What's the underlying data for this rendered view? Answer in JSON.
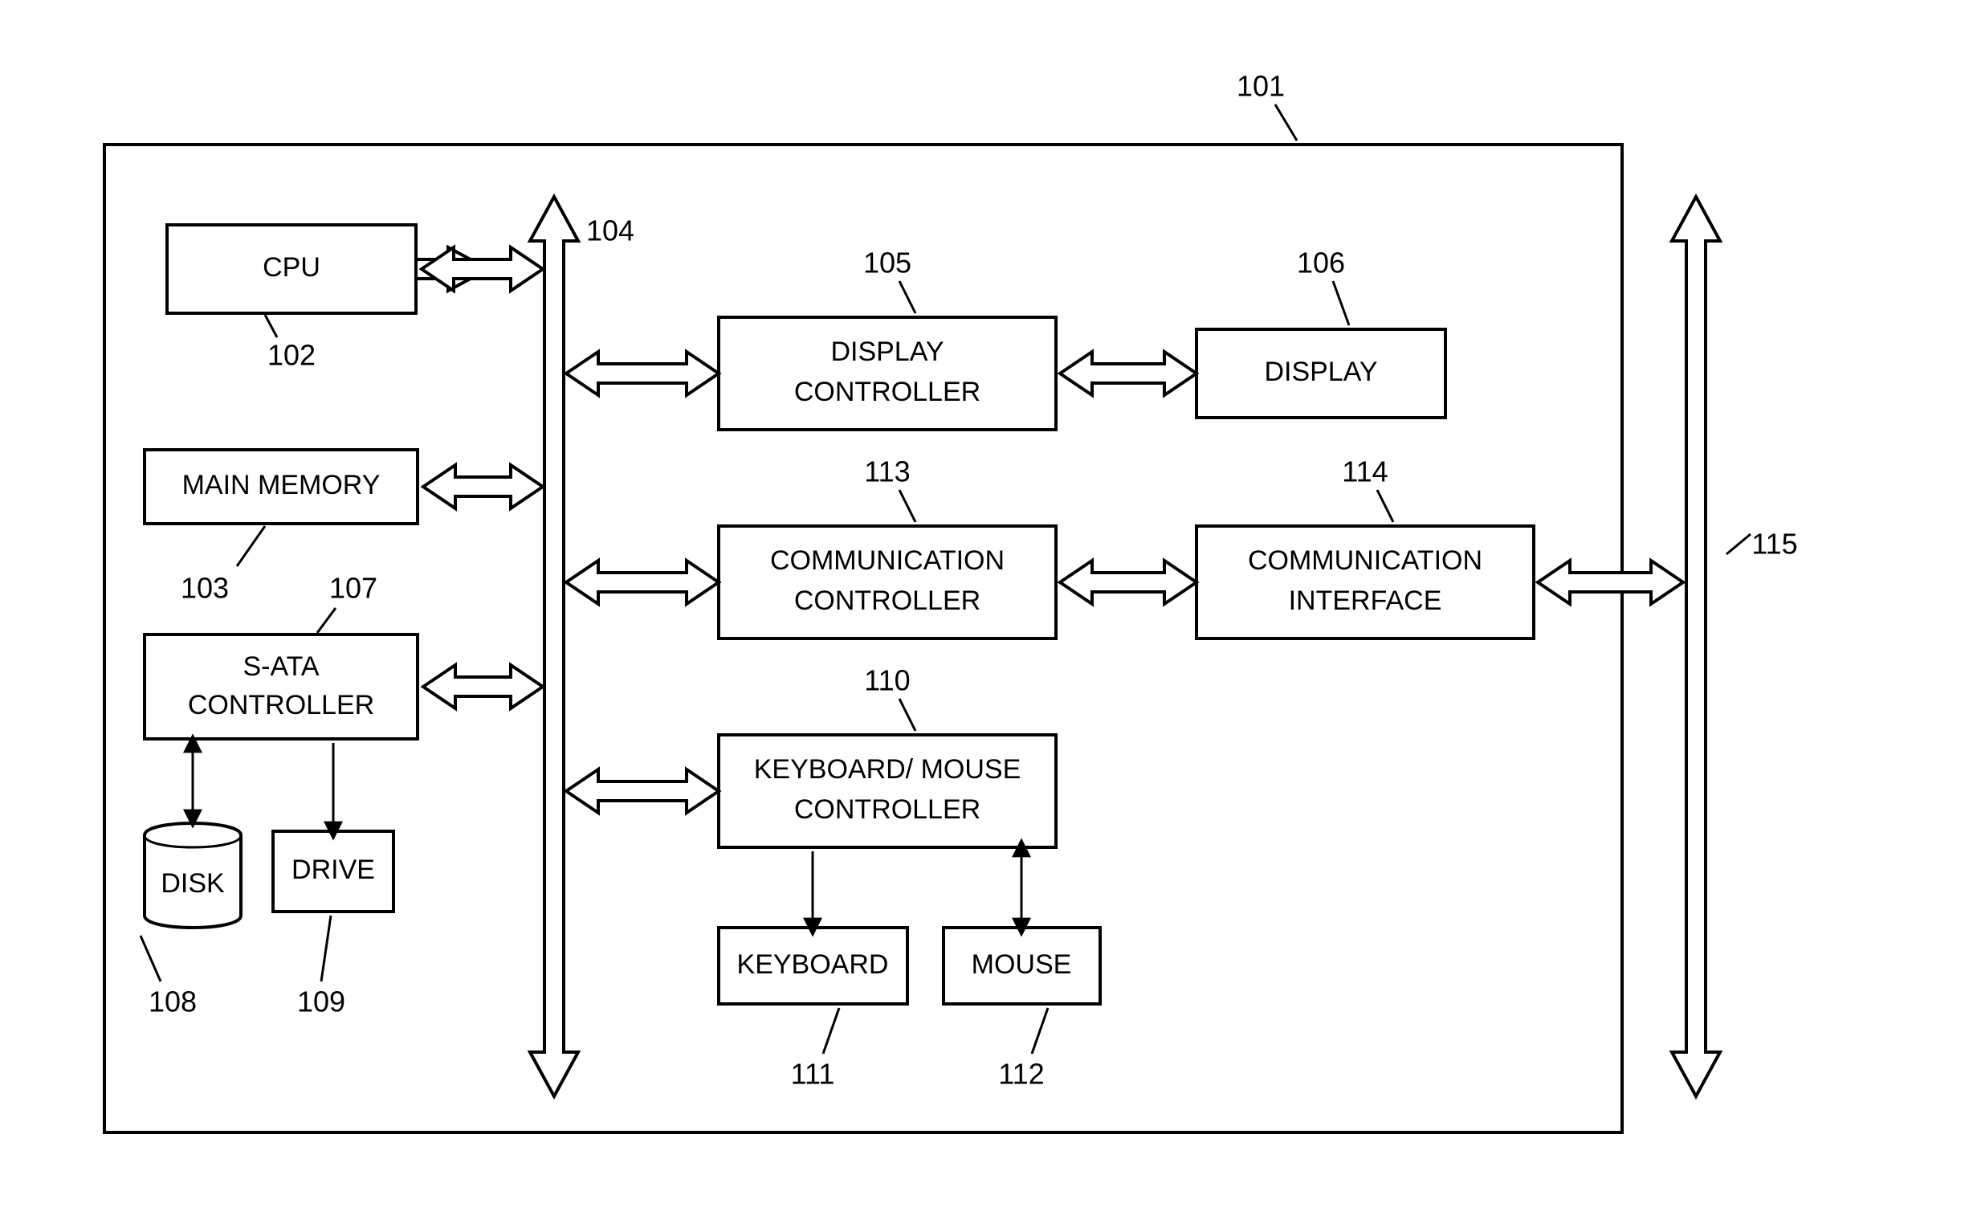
{
  "refs": {
    "system": "101",
    "cpu": "102",
    "mainMemory": "103",
    "bus1": "104",
    "displayController": "105",
    "display": "106",
    "sata": "107",
    "disk": "108",
    "drive": "109",
    "kbmController": "110",
    "keyboard": "111",
    "mouse": "112",
    "commController": "113",
    "commInterface": "114",
    "bus2": "115"
  },
  "labels": {
    "cpu": "CPU",
    "mainMemory": "MAIN MEMORY",
    "sata1": "S-ATA",
    "sata2": "CONTROLLER",
    "disk": "DISK",
    "drive": "DRIVE",
    "displayController1": "DISPLAY",
    "displayController2": "CONTROLLER",
    "display": "DISPLAY",
    "commController1": "COMMUNICATION",
    "commController2": "CONTROLLER",
    "commInterface1": "COMMUNICATION",
    "commInterface2": "INTERFACE",
    "kbm1": "KEYBOARD/ MOUSE",
    "kbm2": "CONTROLLER",
    "keyboard": "KEYBOARD",
    "mouse": "MOUSE"
  }
}
